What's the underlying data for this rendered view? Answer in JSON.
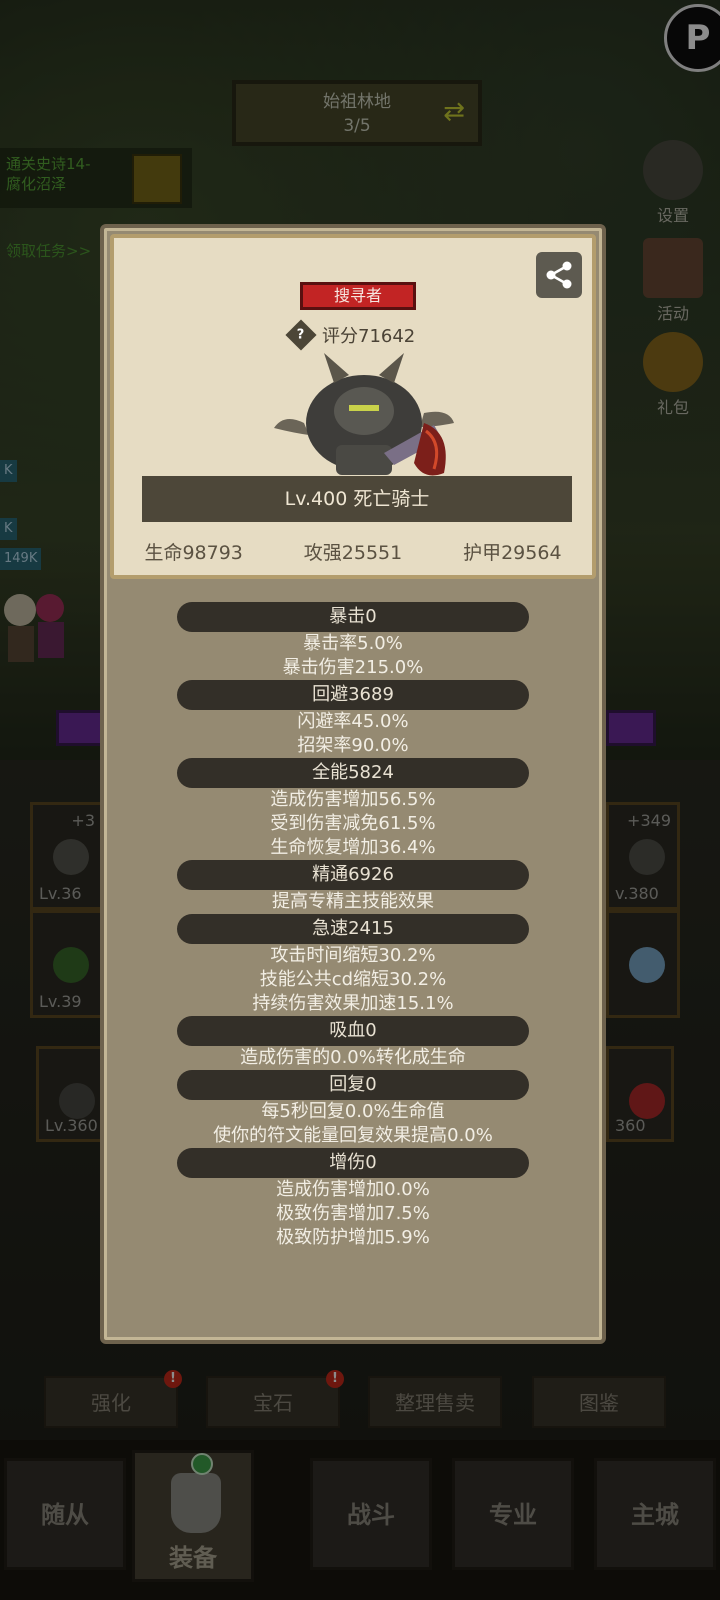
{
  "background": {
    "location": {
      "name": "始祖林地",
      "progress": "3/5"
    },
    "quest": {
      "line1": "通关史诗14-",
      "line2": "腐化沼泽",
      "claim": "领取任务>>"
    },
    "side_buttons": [
      {
        "label": "设置",
        "icon": "gear-icon"
      },
      {
        "label": "活动",
        "icon": "scroll-icon"
      },
      {
        "label": "礼包",
        "icon": "gift-bag-icon"
      }
    ],
    "hp_tags": [
      "K",
      "K",
      "149K"
    ],
    "slots_left": [
      {
        "plus": "+3",
        "level": "Lv.36"
      },
      {
        "plus": "",
        "level": "Lv.39"
      },
      {
        "plus": "",
        "level": "Lv.360"
      }
    ],
    "slots_right": [
      {
        "plus": "+349",
        "level": "v.380"
      },
      {
        "plus": "",
        "level": ""
      },
      {
        "plus": "",
        "level": "360"
      }
    ],
    "action_buttons": [
      {
        "label": "强化",
        "alert": true
      },
      {
        "label": "宝石",
        "alert": true
      },
      {
        "label": "整理售卖",
        "alert": false
      },
      {
        "label": "图鉴",
        "alert": false
      }
    ],
    "nav": [
      "随从",
      "装备",
      "战斗",
      "专业",
      "主城"
    ]
  },
  "modal": {
    "role_tag": "搜寻者",
    "score": "评分71642",
    "hero_name": "Lv.400 死亡骑士",
    "stats": {
      "hp": "生命98793",
      "atk": "攻强25551",
      "armor": "护甲29564"
    },
    "sections": [
      {
        "title": "暴击0",
        "lines": [
          "暴击率5.0%",
          "暴击伤害215.0%"
        ]
      },
      {
        "title": "回避3689",
        "lines": [
          "闪避率45.0%",
          "招架率90.0%"
        ]
      },
      {
        "title": "全能5824",
        "lines": [
          "造成伤害增加56.5%",
          "受到伤害减免61.5%",
          "生命恢复增加36.4%"
        ]
      },
      {
        "title": "精通6926",
        "lines": [
          "提高专精主技能效果"
        ]
      },
      {
        "title": "急速2415",
        "lines": [
          "攻击时间缩短30.2%",
          "技能公共cd缩短30.2%",
          "持续伤害效果加速15.1%"
        ]
      },
      {
        "title": "吸血0",
        "lines": [
          "造成伤害的0.0%转化成生命"
        ]
      },
      {
        "title": "回复0",
        "lines": [
          "每5秒回复0.0%生命值",
          "使你的符文能量回复效果提高0.0%"
        ]
      },
      {
        "title": "增伤0",
        "lines": [
          "造成伤害增加0.0%",
          "极致伤害增加7.5%",
          "极致防护增加5.9%"
        ]
      }
    ]
  }
}
